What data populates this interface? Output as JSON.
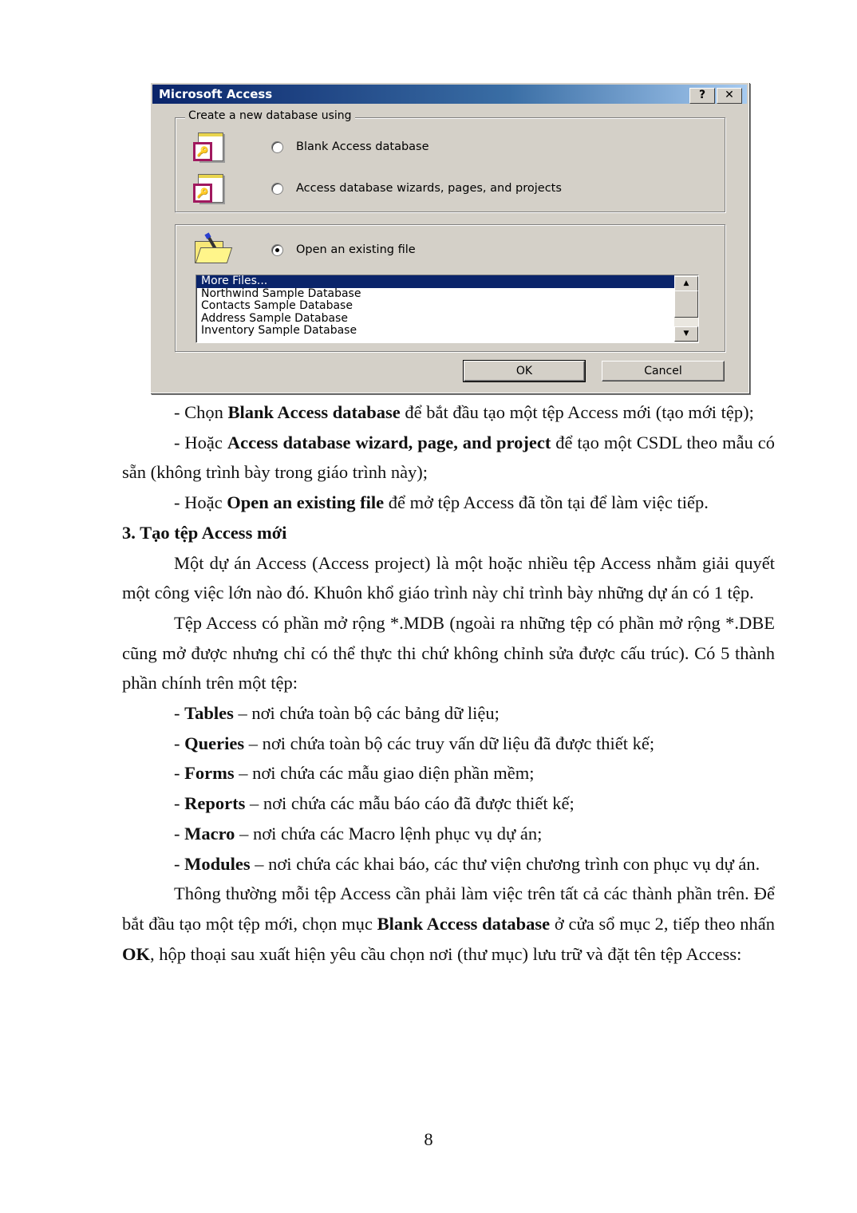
{
  "dialog": {
    "title": "Microsoft Access",
    "help_button": "?",
    "close_button": "✕",
    "create_group": {
      "legend": "Create a new database using",
      "options": [
        {
          "label": "Blank Access database",
          "checked": false,
          "icon": "blank-database-icon"
        },
        {
          "label": "Access database wizards, pages, and projects",
          "checked": false,
          "icon": "database-wizard-icon"
        }
      ]
    },
    "open_group": {
      "option": {
        "label": "Open an existing file",
        "checked": true,
        "icon": "open-folder-icon"
      },
      "files": [
        "More Files...",
        "Northwind Sample Database",
        "Contacts Sample Database",
        "Address Sample Database",
        "Inventory Sample Database"
      ],
      "selected_index": 0
    },
    "ok_label": "OK",
    "cancel_label": "Cancel",
    "icon_key_glyph": "🔑",
    "scroll_up_glyph": "▲",
    "scroll_down_glyph": "▼"
  },
  "document": {
    "bullets_intro": [
      {
        "prefix": "- Chọn ",
        "bold": "Blank Access database",
        "suffix": " để bắt đầu tạo một tệp Access mới (tạo mới tệp);"
      },
      {
        "prefix": "- Hoặc ",
        "bold": "Access database wizard, page, and project",
        "suffix": " để tạo một CSDL theo mẫu có sẵn (không trình bày trong giáo trình này);"
      },
      {
        "prefix": "- Hoặc ",
        "bold": "Open an existing file",
        "suffix": " để mở tệp Access đã tồn tại để làm việc tiếp."
      }
    ],
    "heading": "3. Tạo tệp Access mới",
    "paragraph1": "Một dự án Access (Access project) là một hoặc nhiều tệp Access nhằm giải quyết một công việc lớn nào đó. Khuôn khổ giáo trình này chỉ trình bày những dự án có 1 tệp.",
    "paragraph2": "Tệp Access có phần mở rộng *.MDB (ngoài ra những tệp có phần mở rộng *.DBE cũng mở được nhưng chỉ có thể thực thi chứ không chỉnh sửa được cấu trúc). Có 5 thành phần chính trên một tệp:",
    "components": [
      {
        "prefix": "- ",
        "bold": "Tables",
        "suffix": " – nơi chứa toàn bộ các bảng dữ liệu;"
      },
      {
        "prefix": "- ",
        "bold": "Queries",
        "suffix": " – nơi chứa toàn bộ các truy vấn dữ liệu đã được thiết kế;"
      },
      {
        "prefix": "- ",
        "bold": "Forms",
        "suffix": " – nơi chứa các mẫu giao diện phần mềm;"
      },
      {
        "prefix": "- ",
        "bold": "Reports",
        "suffix": " – nơi chứa các mẫu báo cáo đã được thiết kế;"
      },
      {
        "prefix": "- ",
        "bold": "Macro",
        "suffix": " – nơi chứa các Macro lệnh phục vụ dự án;"
      },
      {
        "prefix": "- ",
        "bold": "Modules",
        "suffix": " – nơi chứa các khai báo, các thư viện chương trình con phục vụ dự án."
      }
    ],
    "final_paragraph": {
      "part1": "Thông thường mỗi tệp Access cần phải làm việc trên tất cả các thành phần trên. Để bắt đầu tạo một tệp mới, chọn mục ",
      "bold1": "Blank Access database",
      "part2": " ở cửa sổ mục 2, tiếp  theo nhấn ",
      "bold2": "OK",
      "part3": ", hộp thoại sau xuất hiện yêu cầu chọn nơi (thư mục) lưu trữ và đặt tên tệp Access:"
    },
    "page_number": "8"
  }
}
